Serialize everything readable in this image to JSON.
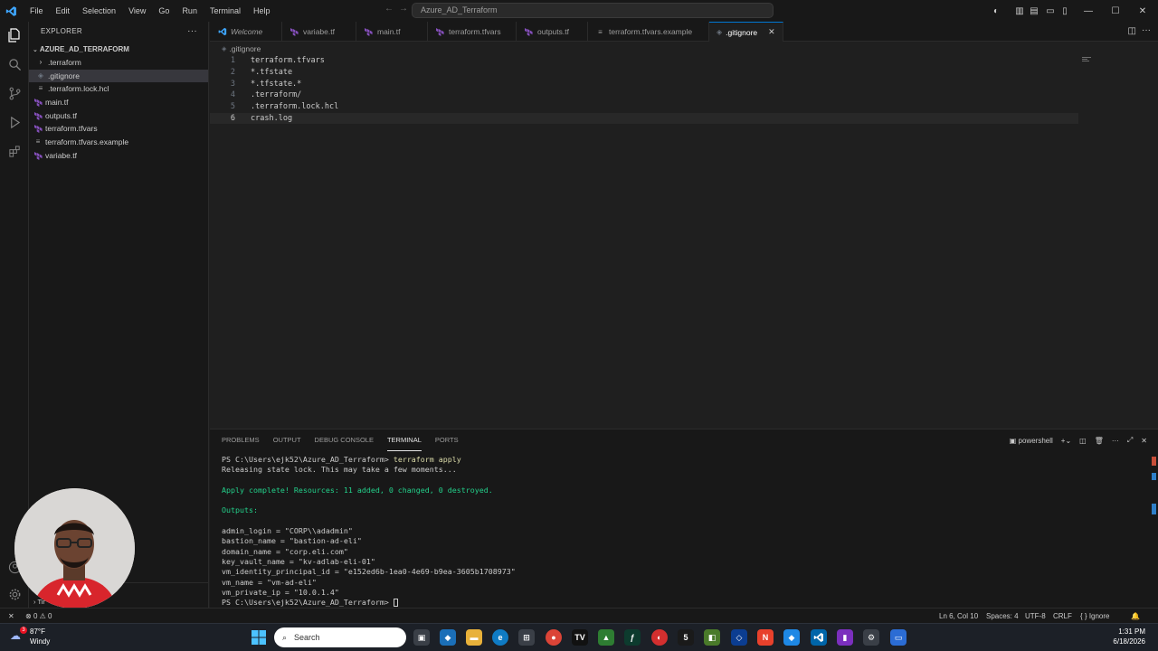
{
  "titlebar": {
    "menus": [
      "File",
      "Edit",
      "Selection",
      "View",
      "Go",
      "Run",
      "Terminal",
      "Help"
    ],
    "search": "Azure_AD_Terraform"
  },
  "sidebar": {
    "header": "EXPLORER",
    "project": "AZURE_AD_TERRAFORM",
    "items": [
      {
        "label": ".terraform",
        "kind": "folder"
      },
      {
        "label": ".gitignore",
        "kind": "gitignore"
      },
      {
        "label": ".terraform.lock.hcl",
        "kind": "file"
      },
      {
        "label": "main.tf",
        "kind": "terraform"
      },
      {
        "label": "outputs.tf",
        "kind": "terraform"
      },
      {
        "label": "terraform.tfvars",
        "kind": "terraform"
      },
      {
        "label": "terraform.tfvars.example",
        "kind": "file"
      },
      {
        "label": "variabe.tf",
        "kind": "terraform"
      }
    ],
    "bottom_label": "Tir"
  },
  "tabs": [
    {
      "label": "Welcome",
      "kind": "vscode"
    },
    {
      "label": "variabe.tf",
      "kind": "terraform"
    },
    {
      "label": "main.tf",
      "kind": "terraform"
    },
    {
      "label": "terraform.tfvars",
      "kind": "terraform"
    },
    {
      "label": "outputs.tf",
      "kind": "terraform"
    },
    {
      "label": "terraform.tfvars.example",
      "kind": "file"
    },
    {
      "label": ".gitignore",
      "kind": "gitignore"
    }
  ],
  "editor": {
    "breadcrumb": ".gitignore",
    "lines": [
      "terraform.tfvars",
      "*.tfstate",
      "*.tfstate.*",
      ".terraform/",
      ".terraform.lock.hcl",
      "crash.log"
    ],
    "line_numbers": [
      "1",
      "2",
      "3",
      "4",
      "5",
      "6"
    ]
  },
  "panel": {
    "tabs": [
      "PROBLEMS",
      "OUTPUT",
      "DEBUG CONSOLE",
      "TERMINAL",
      "PORTS"
    ],
    "shell": "powershell",
    "terminal": {
      "prompt1": "PS C:\\Users\\ejk52\\Azure_AD_Terraform> ",
      "command1": "terraform apply",
      "line_lock": "Releasing state lock. This may take a few moments...",
      "line_apply": "Apply complete! Resources: 11 added, 0 changed, 0 destroyed.",
      "line_outputs": "Outputs:",
      "outputs": [
        "admin_login = \"CORP\\\\adadmin\"",
        "bastion_name = \"bastion-ad-eli\"",
        "domain_name = \"corp.eli.com\"",
        "key_vault_name = \"kv-adlab-eli-01\"",
        "vm_identity_principal_id = \"e152ed6b-1ea0-4e69-b9ea-3605b1708973\"",
        "vm_name = \"vm-ad-eli\"",
        "vm_private_ip = \"10.0.1.4\""
      ],
      "prompt2": "PS C:\\Users\\ejk52\\Azure_AD_Terraform> "
    }
  },
  "statusbar": {
    "errors": "0",
    "warnings": "0",
    "position": "Ln 6, Col 10",
    "spaces": "Spaces: 4",
    "encoding": "UTF-8",
    "eol": "CRLF",
    "language": "Ignore"
  },
  "taskbar": {
    "temp": "87°F",
    "weather": "Windy",
    "search": "Search",
    "time": "1:31 PM",
    "date": "6/18/2026",
    "badge": "3"
  },
  "colors": {
    "accent": "#0078d4",
    "terraform": "#844fba",
    "terminal_green": "#23d18b"
  }
}
